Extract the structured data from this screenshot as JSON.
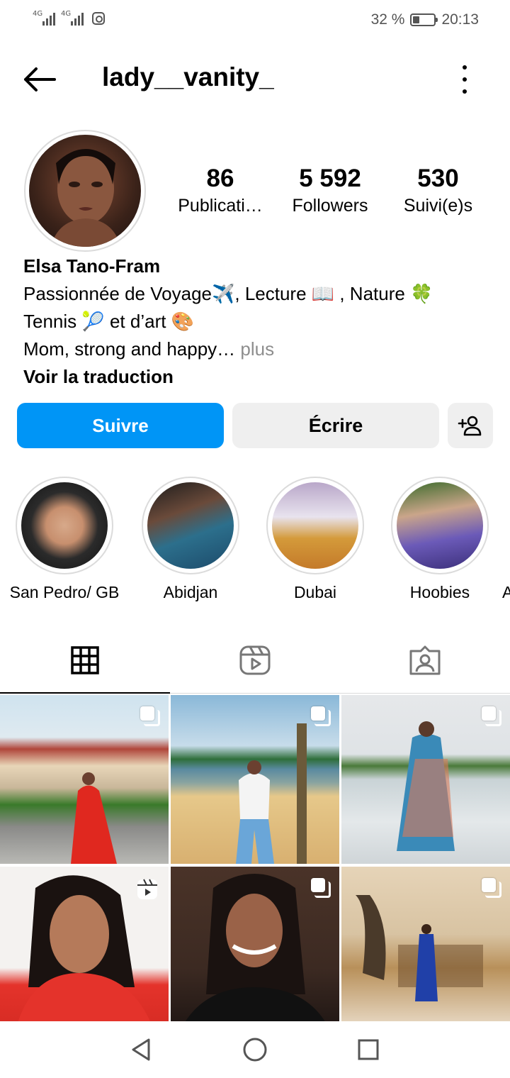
{
  "status_bar": {
    "network_1": "4G",
    "network_2": "4G",
    "battery_text": "32 %",
    "battery_level": 0.32,
    "time": "20:13"
  },
  "header": {
    "username": "lady__vanity_",
    "back_icon": "arrow-left-icon",
    "menu_icon": "more-vertical-icon"
  },
  "profile": {
    "stats": [
      {
        "value": "86",
        "label": "Publicati…"
      },
      {
        "value": "5 592",
        "label": "Followers"
      },
      {
        "value": "530",
        "label": "Suivi(e)s"
      }
    ],
    "name": "Elsa Tano-Fram",
    "bio_line_1": "Passionnée de Voyage✈️, Lecture 📖 , Nature 🍀",
    "bio_line_2": "Tennis 🎾 et d’art 🎨",
    "bio_line_3": "Mom, strong and happy…",
    "more_link": " plus",
    "translate": "Voir la traduction"
  },
  "actions": {
    "follow": "Suivre",
    "message": "Écrire",
    "add_user_icon": "add-person-icon"
  },
  "highlights": [
    {
      "label": "San Pedro/ GB"
    },
    {
      "label": "Abidjan"
    },
    {
      "label": "Dubai"
    },
    {
      "label": "Hoobies"
    },
    {
      "label": "A"
    }
  ],
  "tabs": [
    {
      "name": "grid-icon",
      "active": true
    },
    {
      "name": "reels-icon",
      "active": false
    },
    {
      "name": "tagged-icon",
      "active": false
    }
  ],
  "posts": [
    {
      "type": "carousel"
    },
    {
      "type": "carousel"
    },
    {
      "type": "carousel"
    },
    {
      "type": "reel"
    },
    {
      "type": "carousel"
    },
    {
      "type": "carousel"
    }
  ],
  "colors": {
    "accent": "#0095f6",
    "secondary_button": "#efefef",
    "muted_text": "#8e8e8e"
  }
}
